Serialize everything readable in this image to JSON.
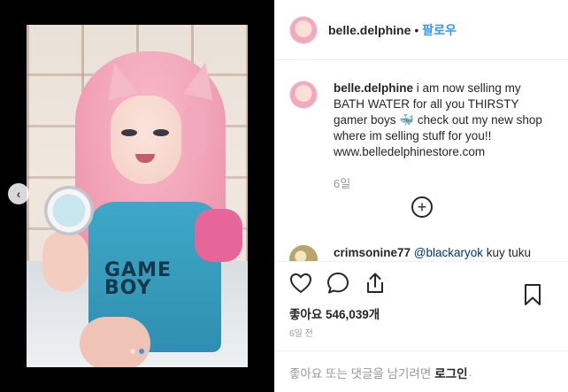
{
  "post": {
    "username": "belle.delphine",
    "separator": "•",
    "follow_label": "팔로우",
    "caption_text": "i am now selling my BATH WATER for all you THIRSTY gamer boys 🐳 check out my new shop where im selling stuff for you!! www.belledelphinestore.com",
    "caption_age": "6일",
    "load_more_symbol": "+",
    "shirt_print": "GAME BOY"
  },
  "comment": {
    "username": "crimsonine77",
    "mention": "@blackaryok",
    "text": "kuy tuku"
  },
  "actions": {
    "likes_text": "좋아요 546,039개",
    "timestamp": "6일 전",
    "icons": [
      "heart-icon",
      "comment-icon",
      "share-icon",
      "bookmark-icon"
    ]
  },
  "footer": {
    "prefix": "좋아요 또는 댓글을 남기려면",
    "login_label": "로그인",
    "suffix": "."
  },
  "carousel": {
    "prev_symbol": "‹",
    "dot_count": 2,
    "active_dot": 2
  },
  "colors": {
    "link": "#3897f0",
    "text": "#262626",
    "muted": "#999999",
    "mention": "#003569"
  }
}
